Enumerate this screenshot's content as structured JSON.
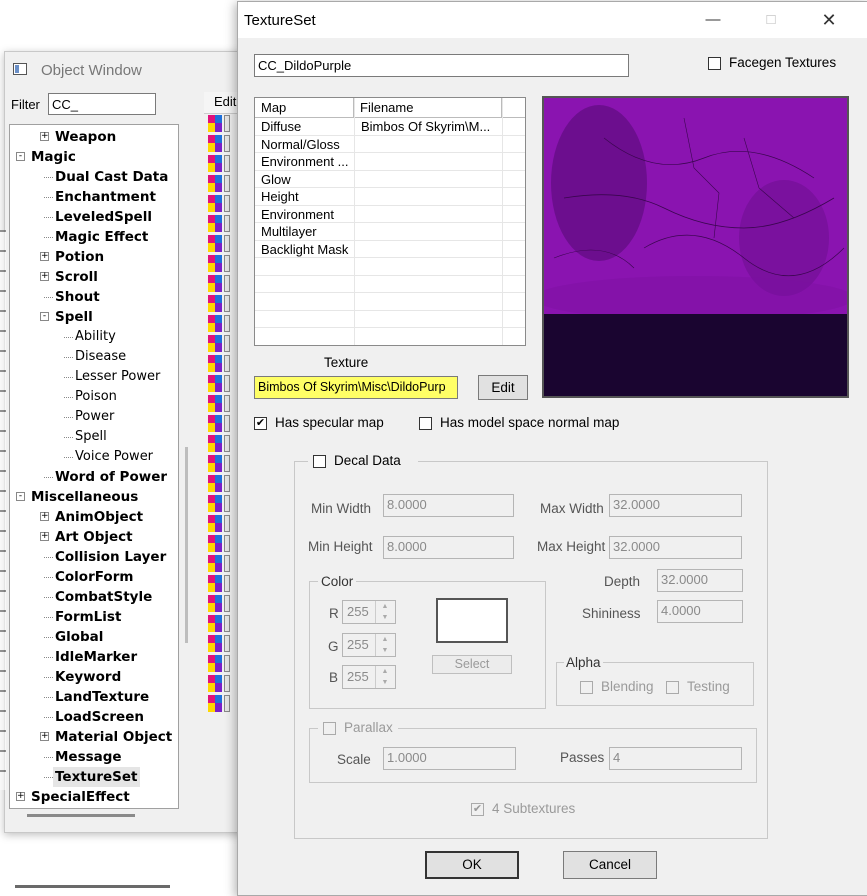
{
  "object_window": {
    "title": "Object Window",
    "filter_label": "Filter",
    "filter_value": "CC_",
    "edit_column_label": "Edit",
    "tree": [
      {
        "label": "Weapon",
        "level": 1,
        "expander": "+",
        "bold": true
      },
      {
        "label": "Magic",
        "level": 0,
        "expander": "−",
        "bold": true
      },
      {
        "label": "Dual Cast Data",
        "level": 1,
        "expander": "",
        "bold": true
      },
      {
        "label": "Enchantment",
        "level": 1,
        "expander": "",
        "bold": true
      },
      {
        "label": "LeveledSpell",
        "level": 1,
        "expander": "",
        "bold": true
      },
      {
        "label": "Magic Effect",
        "level": 1,
        "expander": "",
        "bold": true
      },
      {
        "label": "Potion",
        "level": 1,
        "expander": "+",
        "bold": true
      },
      {
        "label": "Scroll",
        "level": 1,
        "expander": "+",
        "bold": true
      },
      {
        "label": "Shout",
        "level": 1,
        "expander": "",
        "bold": true
      },
      {
        "label": "Spell",
        "level": 1,
        "expander": "−",
        "bold": true
      },
      {
        "label": "Ability",
        "level": 2,
        "expander": "",
        "bold": false
      },
      {
        "label": "Disease",
        "level": 2,
        "expander": "",
        "bold": false
      },
      {
        "label": "Lesser Power",
        "level": 2,
        "expander": "",
        "bold": false
      },
      {
        "label": "Poison",
        "level": 2,
        "expander": "",
        "bold": false
      },
      {
        "label": "Power",
        "level": 2,
        "expander": "",
        "bold": false
      },
      {
        "label": "Spell",
        "level": 2,
        "expander": "",
        "bold": false
      },
      {
        "label": "Voice Power",
        "level": 2,
        "expander": "",
        "bold": false
      },
      {
        "label": "Word of Power",
        "level": 1,
        "expander": "",
        "bold": true
      },
      {
        "label": "Miscellaneous",
        "level": 0,
        "expander": "−",
        "bold": true
      },
      {
        "label": "AnimObject",
        "level": 1,
        "expander": "+",
        "bold": true
      },
      {
        "label": "Art Object",
        "level": 1,
        "expander": "+",
        "bold": true
      },
      {
        "label": "Collision Layer",
        "level": 1,
        "expander": "",
        "bold": true
      },
      {
        "label": "ColorForm",
        "level": 1,
        "expander": "",
        "bold": true
      },
      {
        "label": "CombatStyle",
        "level": 1,
        "expander": "",
        "bold": true
      },
      {
        "label": "FormList",
        "level": 1,
        "expander": "",
        "bold": true
      },
      {
        "label": "Global",
        "level": 1,
        "expander": "",
        "bold": true
      },
      {
        "label": "IdleMarker",
        "level": 1,
        "expander": "",
        "bold": true
      },
      {
        "label": "Keyword",
        "level": 1,
        "expander": "",
        "bold": true
      },
      {
        "label": "LandTexture",
        "level": 1,
        "expander": "",
        "bold": true
      },
      {
        "label": "LoadScreen",
        "level": 1,
        "expander": "",
        "bold": true
      },
      {
        "label": "Material Object",
        "level": 1,
        "expander": "+",
        "bold": true
      },
      {
        "label": "Message",
        "level": 1,
        "expander": "",
        "bold": true
      },
      {
        "label": "TextureSet",
        "level": 1,
        "expander": "",
        "bold": true,
        "selected": true
      },
      {
        "label": "SpecialEffect",
        "level": 0,
        "expander": "+",
        "bold": true
      }
    ]
  },
  "dialog": {
    "title": "TextureSet",
    "editor_id": "CC_DildoPurple",
    "facegen_label": "Facegen Textures",
    "facegen_checked": false,
    "map_header": "Map",
    "filename_header": "Filename",
    "maps": [
      {
        "map": "Diffuse",
        "filename": "Bimbos Of Skyrim\\M..."
      },
      {
        "map": "Normal/Gloss",
        "filename": ""
      },
      {
        "map": "Environment ...",
        "filename": ""
      },
      {
        "map": "Glow",
        "filename": ""
      },
      {
        "map": "Height",
        "filename": ""
      },
      {
        "map": "Environment",
        "filename": ""
      },
      {
        "map": "Multilayer",
        "filename": ""
      },
      {
        "map": "Backlight Mask",
        "filename": ""
      }
    ],
    "texture_label": "Texture",
    "texture_path": "Bimbos Of Skyrim\\Misc\\DildoPurp",
    "edit_button": "Edit",
    "has_specular_label": "Has specular map",
    "has_specular_checked": true,
    "model_space_label": "Has model space normal map",
    "model_space_checked": false,
    "decal": {
      "label": "Decal Data",
      "min_width_label": "Min Width",
      "min_width": "8.0000",
      "max_width_label": "Max Width",
      "max_width": "32.0000",
      "min_height_label": "Min Height",
      "min_height": "8.0000",
      "max_height_label": "Max Height",
      "max_height": "32.0000",
      "depth_label": "Depth",
      "depth": "32.0000",
      "shininess_label": "Shininess",
      "shininess": "4.0000",
      "color_label": "Color",
      "r_label": "R",
      "r": "255",
      "g_label": "G",
      "g": "255",
      "b_label": "B",
      "b": "255",
      "select_button": "Select",
      "alpha_label": "Alpha",
      "blending_label": "Blending",
      "testing_label": "Testing",
      "parallax_label": "Parallax",
      "scale_label": "Scale",
      "scale": "1.0000",
      "passes_label": "Passes",
      "passes": "4",
      "subtextures_label": "4 Subtextures"
    },
    "ok_button": "OK",
    "cancel_button": "Cancel",
    "colors": {
      "texture_highlight": "#ffff66",
      "preview_purple": "#8a14b0",
      "preview_dark": "#1a0530"
    }
  }
}
